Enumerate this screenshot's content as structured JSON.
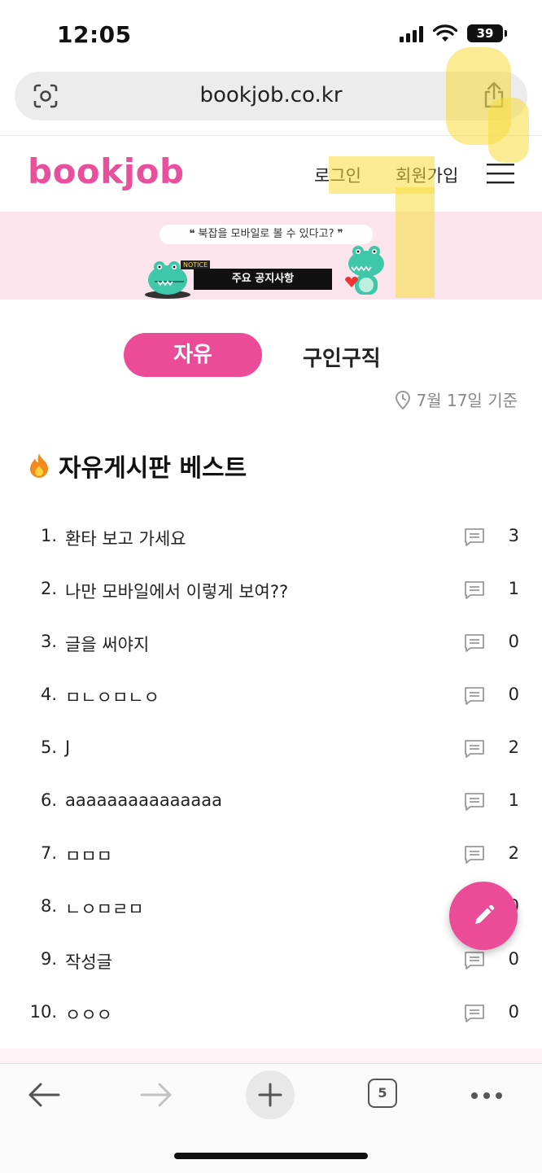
{
  "status_bar": {
    "time": "12:05",
    "battery": "39"
  },
  "browser": {
    "url": "bookjob.co.kr",
    "tab_count": "5"
  },
  "site": {
    "logo": "bookjob",
    "login_label": "로그인",
    "signup_label": "회원가입",
    "brand_color": "#e9509b"
  },
  "banner": {
    "bubble_text": "❝ 북잡을 모바일로 볼 수 있다고? ❞",
    "notice_tag": "NOTICE",
    "bar_text": "주요 공지사항"
  },
  "tabs": [
    {
      "label": "자유",
      "active": true
    },
    {
      "label": "구인구직",
      "active": false
    }
  ],
  "basis_text": "7월 17일 기준",
  "board": {
    "title": "자유게시판 베스트",
    "posts": [
      {
        "num": "1.",
        "title": "환타 보고 가세요",
        "comments": "3"
      },
      {
        "num": "2.",
        "title": "나만 모바일에서 이렇게 보여??",
        "comments": "1"
      },
      {
        "num": "3.",
        "title": "글을 써야지",
        "comments": "0"
      },
      {
        "num": "4.",
        "title": "ㅁㄴㅇㅁㄴㅇ",
        "comments": "0"
      },
      {
        "num": "5.",
        "title": "J",
        "comments": "2"
      },
      {
        "num": "6.",
        "title": "aaaaaaaaaaaaaaa",
        "comments": "1"
      },
      {
        "num": "7.",
        "title": "ㅁㅁㅁ",
        "comments": "2"
      },
      {
        "num": "8.",
        "title": "ㄴㅇㅁㄹㅁ",
        "comments": "0"
      },
      {
        "num": "9.",
        "title": "작성글",
        "comments": "0"
      },
      {
        "num": "10.",
        "title": "ㅇㅇㅇ",
        "comments": "0"
      }
    ]
  },
  "icons": {
    "lens": "lens-icon",
    "share": "share-icon",
    "menu": "hamburger-menu-icon",
    "clock": "clock-icon",
    "fire": "fire-icon",
    "comment": "comment-icon",
    "pencil": "pencil-icon"
  }
}
